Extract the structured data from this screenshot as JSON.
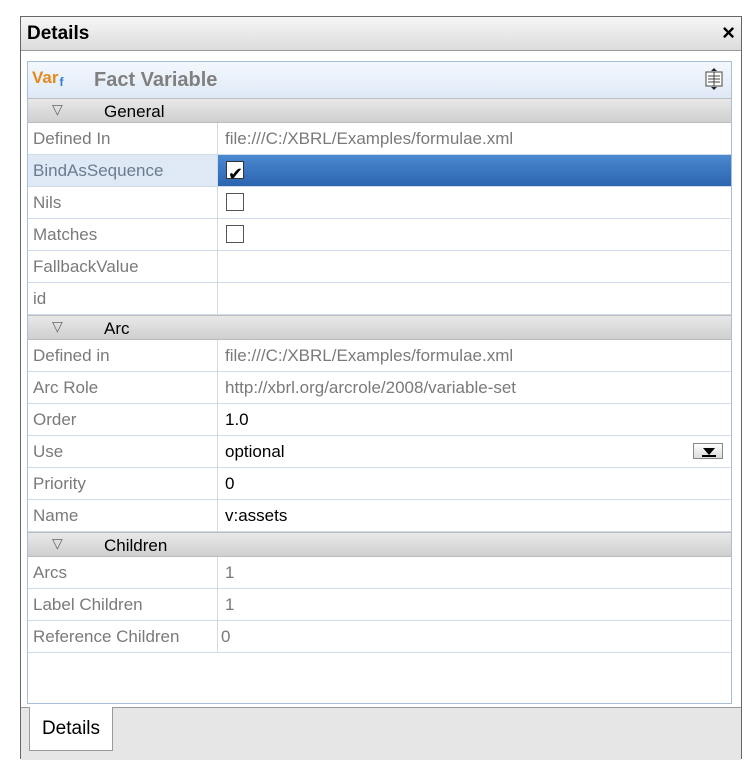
{
  "window": {
    "title": "Details",
    "close_glyph": "×"
  },
  "header": {
    "logo_main": "Var",
    "logo_sub": "f",
    "title": "Fact Variable",
    "tool_icon": "collapse-expand-icon"
  },
  "sections": {
    "general": {
      "label": "General",
      "rows": [
        {
          "key": "Defined In",
          "value": "file:///C:/XBRL/Examples/formulae.xml"
        },
        {
          "key": "BindAsSequence",
          "checked": true
        },
        {
          "key": "Nils",
          "checked": false
        },
        {
          "key": "Matches",
          "checked": false
        },
        {
          "key": "FallbackValue",
          "value": ""
        },
        {
          "key": "id",
          "value": ""
        }
      ]
    },
    "arc": {
      "label": "Arc",
      "rows": [
        {
          "key": "Defined in",
          "value": "file:///C:/XBRL/Examples/formulae.xml"
        },
        {
          "key": "Arc Role",
          "value": "http://xbrl.org/arcrole/2008/variable-set"
        },
        {
          "key": "Order",
          "value": "1.0"
        },
        {
          "key": "Use",
          "value": "optional"
        },
        {
          "key": "Priority",
          "value": "0"
        },
        {
          "key": "Name",
          "value": "v:assets"
        }
      ]
    },
    "children": {
      "label": "Children",
      "rows": [
        {
          "key": "Arcs",
          "value": "1"
        },
        {
          "key": "Label Children",
          "value": "1"
        },
        {
          "key": "Reference Children",
          "value": "0"
        }
      ]
    }
  },
  "tabs": [
    {
      "label": "Details",
      "active": true
    }
  ],
  "colors": {
    "selection": "#3a78c6",
    "section_bg": "#d9d9d9",
    "logo_orange": "#e68a1f",
    "logo_blue": "#2e7bd6"
  }
}
